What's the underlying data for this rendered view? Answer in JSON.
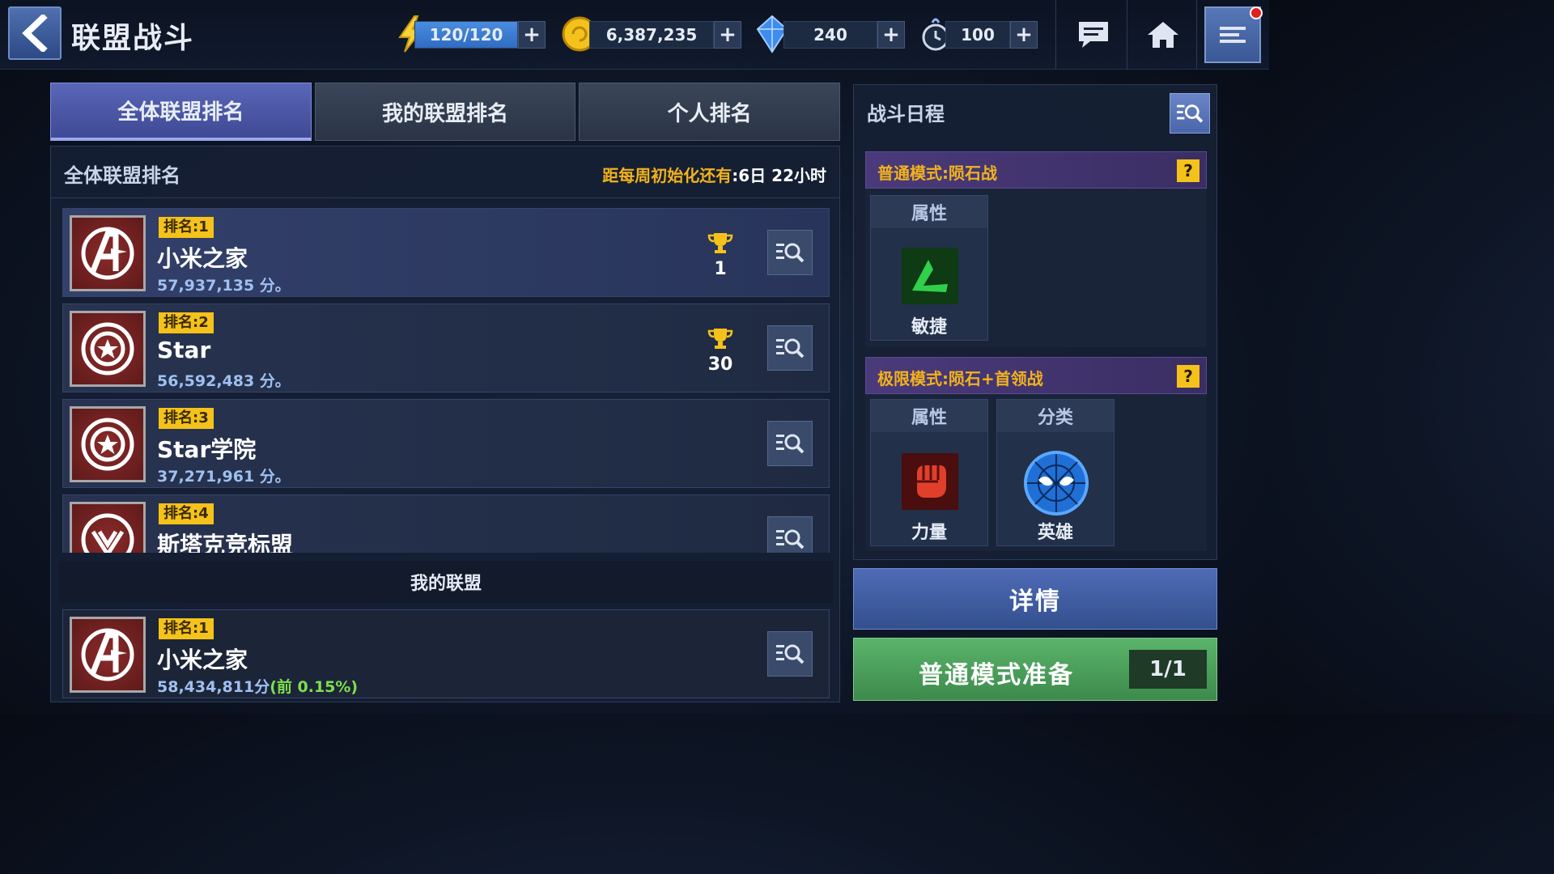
{
  "header": {
    "title": "联盟战斗",
    "energy": "120/120",
    "gold": "6,387,235",
    "crystals": "240",
    "stamina": "100",
    "plus": "+"
  },
  "tabs": [
    {
      "label": "全体联盟排名",
      "active": true
    },
    {
      "label": "我的联盟排名",
      "active": false
    },
    {
      "label": "个人排名",
      "active": false
    }
  ],
  "ranking": {
    "title": "全体联盟排名",
    "reset_label": "距每周初始化还有",
    "reset_value": ":6日 22小时",
    "rows": [
      {
        "rank": "排名:1",
        "name": "小米之家",
        "score": "57,937,135 分。",
        "emblem": "avengers-emblem",
        "trophy": "1"
      },
      {
        "rank": "排名:2",
        "name": "Star",
        "score": "56,592,483 分。",
        "emblem": "shield-star-emblem",
        "trophy": "30"
      },
      {
        "rank": "排名:3",
        "name": "Star学院",
        "score": "37,271,961 分。",
        "emblem": "shield-star-emblem",
        "trophy": ""
      },
      {
        "rank": "排名:4",
        "name": "斯塔克竞标盟",
        "score": "",
        "emblem": "stark-emblem",
        "trophy": ""
      }
    ]
  },
  "my_alliance": {
    "title": "我的联盟",
    "rank": "排名:1",
    "name": "小米之家",
    "score": "58,434,811分",
    "pct": "(前 0.15%)"
  },
  "schedule": {
    "title": "战斗日程",
    "normal_mode": {
      "label": "普通模式:陨石战",
      "help": "?",
      "attr_head": "属性",
      "attr_label": "敏捷"
    },
    "extreme_mode": {
      "label": "极限模式:陨石+首领战",
      "help": "?",
      "attr_head": "属性",
      "attr_label": "力量",
      "class_head": "分类",
      "class_label": "英雄"
    }
  },
  "buttons": {
    "details": "详情",
    "prepare": "普通模式准备",
    "prepare_count": "1/1"
  },
  "colors": {
    "accent_gold": "#f2b21c",
    "rank_badge": "#f4c21a",
    "score_blue": "#9fc0f0",
    "pct_green": "#7ee04a",
    "details_button": "#4f6bb6",
    "prepare_button": "#5ab46a"
  }
}
